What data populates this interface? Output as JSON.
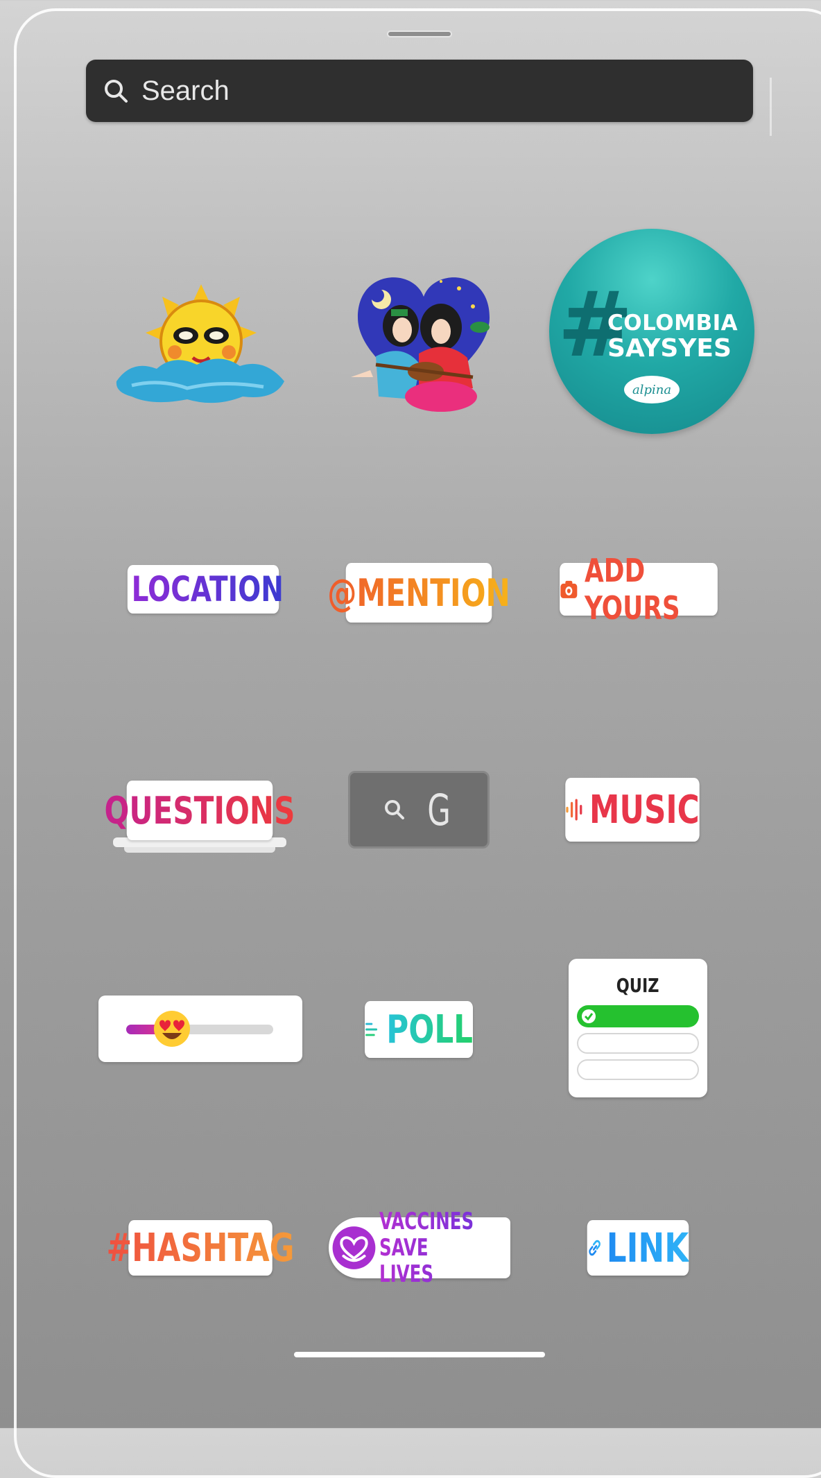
{
  "search": {
    "placeholder": "Search",
    "icon": "search-icon"
  },
  "stickers": {
    "row1": {
      "sun": {
        "icon": "sun-cloud-sticker"
      },
      "couple": {
        "icon": "couple-guitar-sticker"
      },
      "colombia": {
        "hash": "#",
        "line1": "COLOMBIA",
        "line2": "SAYSYES",
        "brand": "alpina",
        "accent": "#1aa7a7"
      }
    },
    "location": {
      "label": "LOCATION",
      "icon": "location-pin-icon"
    },
    "mention": {
      "label": "@MENTION"
    },
    "add_yours": {
      "label": "ADD YOURS",
      "icon": "camera-icon"
    },
    "questions": {
      "label": "QUESTIONS"
    },
    "gif": {
      "label": "G",
      "icon": "search-icon"
    },
    "music": {
      "label": "MUSIC",
      "icon": "audio-bars-icon"
    },
    "slider": {
      "emoji": "heart-eyes-emoji",
      "level": 0.22
    },
    "poll": {
      "label": "POLL",
      "icon": "poll-lines-icon"
    },
    "quiz": {
      "label": "QUIZ",
      "options": 3,
      "correct_color": "#25c12f"
    },
    "hashtag": {
      "label": "#HASHTAG"
    },
    "vaccines": {
      "line1": "VACCINES",
      "line2": "SAVE LIVES",
      "icon": "heart-hands-icon"
    },
    "link": {
      "label": "LINK",
      "icon": "link-icon"
    }
  }
}
